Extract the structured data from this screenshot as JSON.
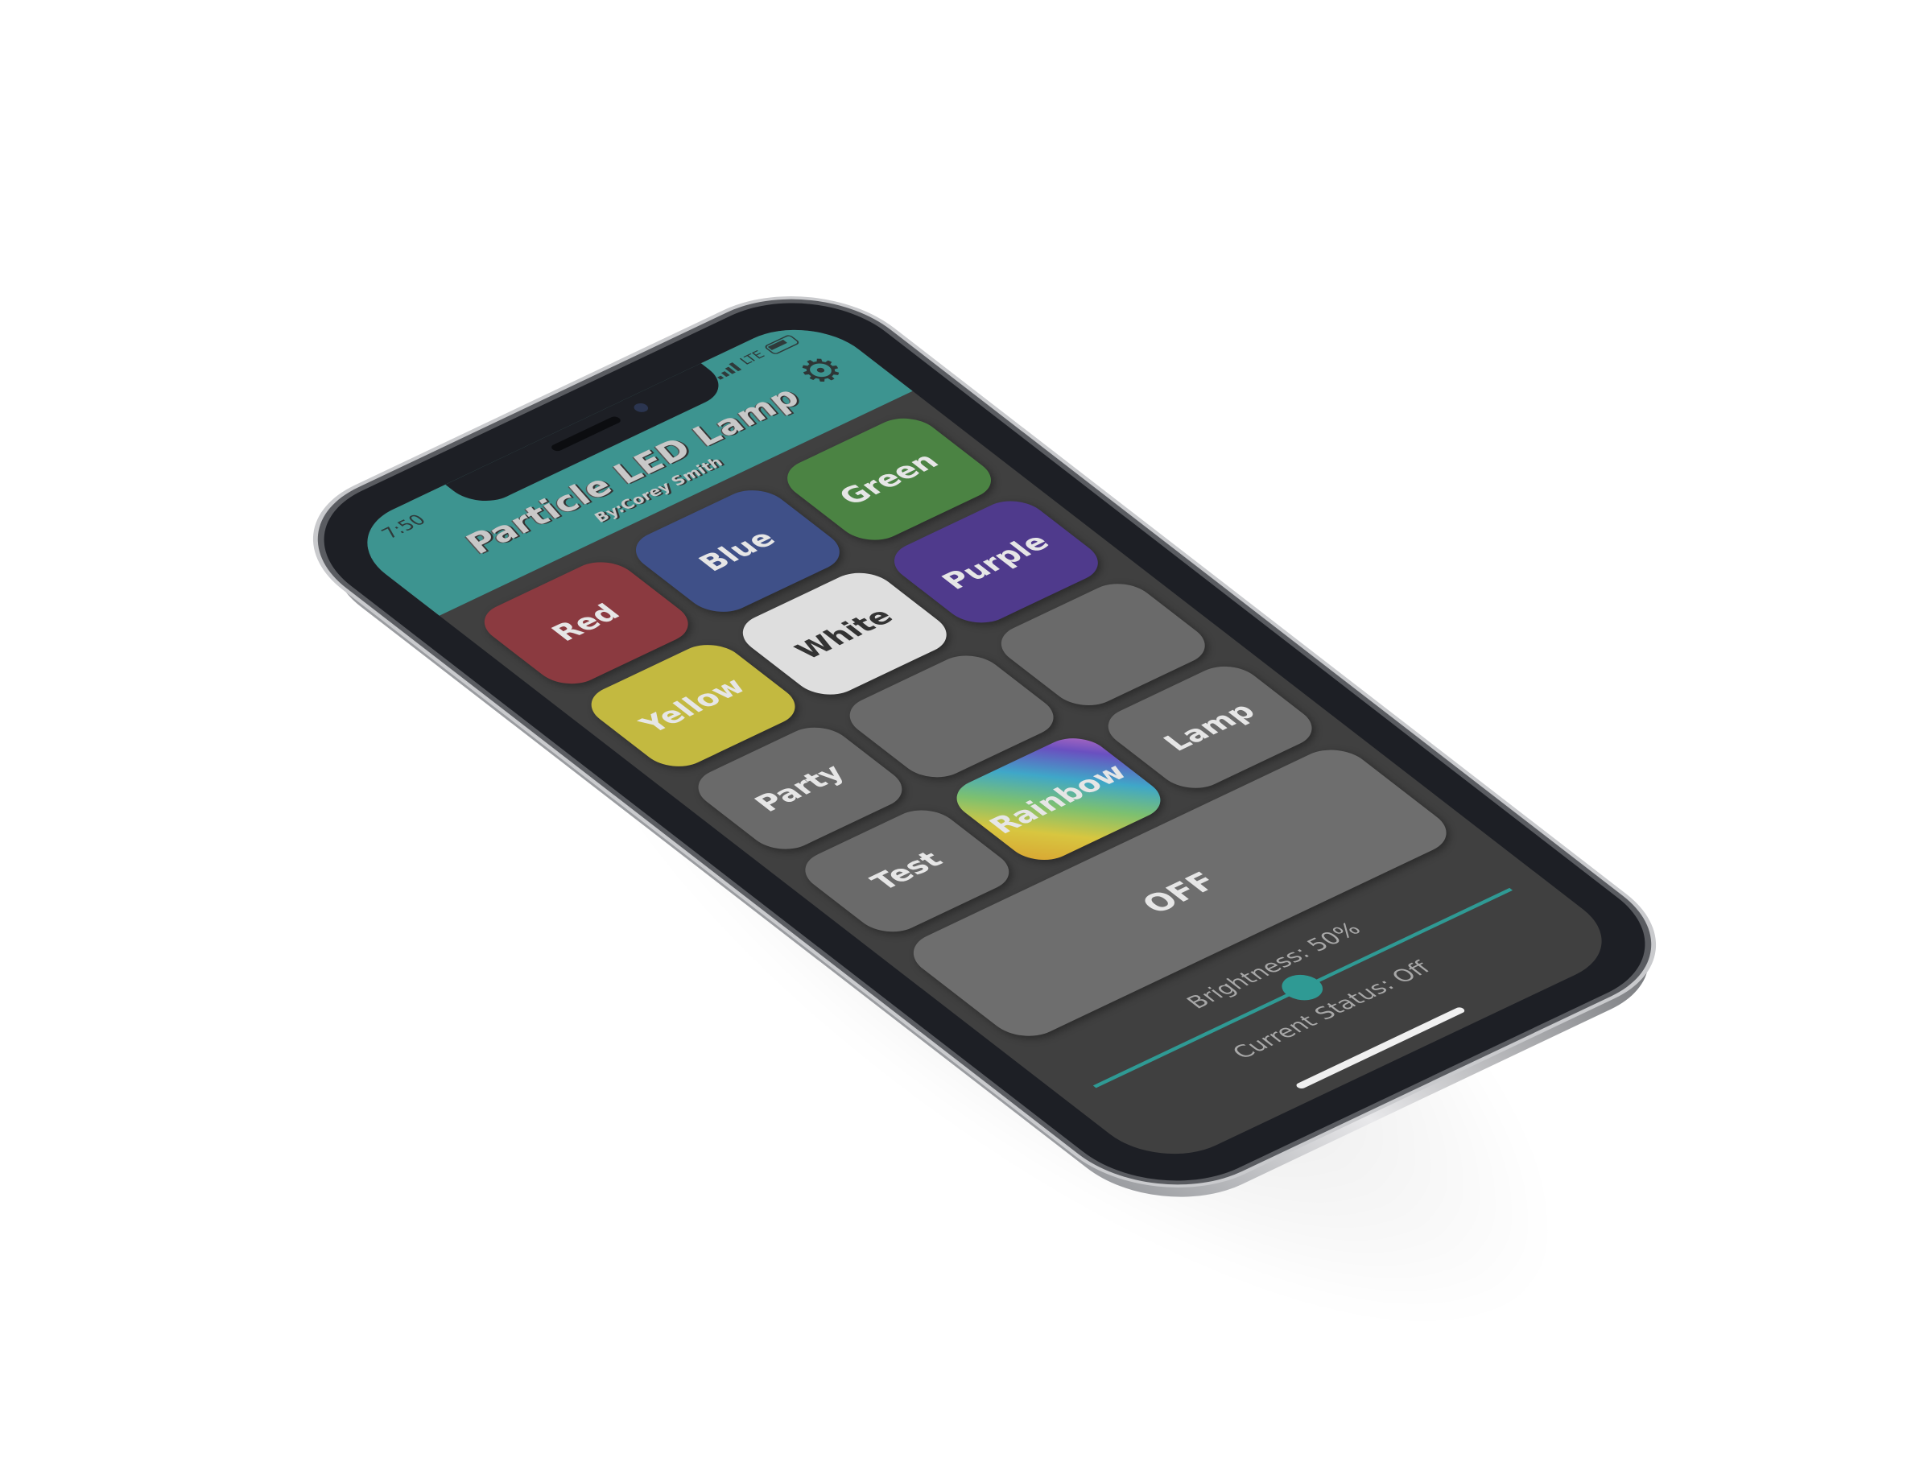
{
  "status_bar": {
    "time": "7:50",
    "network": "LTE"
  },
  "header": {
    "title": "Particle LED Lamp",
    "subtitle": "By:Corey Smith",
    "settings_icon": "gear-icon"
  },
  "buttons": [
    {
      "label": "Red",
      "color": "#8b3a40"
    },
    {
      "label": "Blue",
      "color": "#3f5088"
    },
    {
      "label": "Green",
      "color": "#4b8343"
    },
    {
      "label": "Yellow",
      "color": "#c3b940"
    },
    {
      "label": "White",
      "color": "#dedede"
    },
    {
      "label": "Purple",
      "color": "#4f3a8c"
    },
    {
      "label": "Party",
      "color": "#6a6a6a"
    },
    {
      "label": "",
      "color": "#6a6a6a"
    },
    {
      "label": "",
      "color": "#6a6a6a"
    },
    {
      "label": "Test",
      "color": "#6a6a6a"
    },
    {
      "label": "Rainbow",
      "color": "rainbow"
    },
    {
      "label": "Lamp",
      "color": "#6a6a6a"
    }
  ],
  "off_button": {
    "label": "OFF"
  },
  "brightness": {
    "label": "Brightness: 50%",
    "value": 50
  },
  "current_status": "Current Status: Off",
  "colors": {
    "accent": "#2f9a94",
    "header": "#3d9490",
    "background": "#404040"
  }
}
